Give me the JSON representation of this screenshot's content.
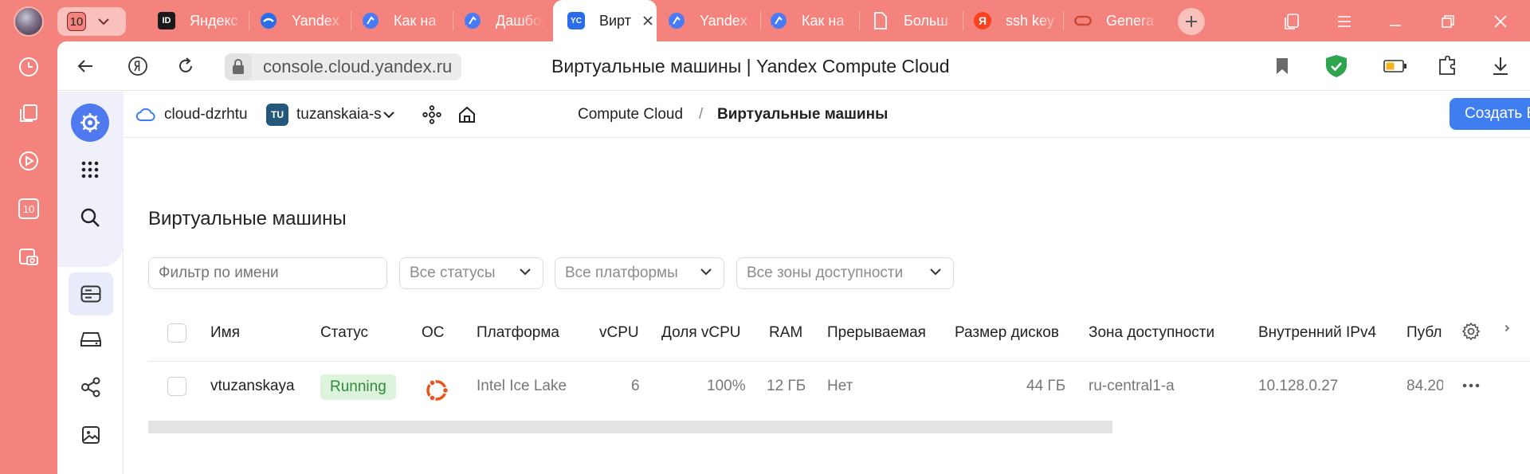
{
  "browser": {
    "counter": "10",
    "tabs": [
      {
        "label": "Яндекс",
        "icon": "id-icon",
        "color": "#1a1a1a"
      },
      {
        "label": "Yandex",
        "icon": "cloud-logo-icon",
        "color": "#2b6de8"
      },
      {
        "label": "Как на",
        "icon": "cloud-hand-icon",
        "color": "#4a7af5"
      },
      {
        "label": "Дашбор",
        "icon": "cloud-hand-icon",
        "color": "#4a7af5"
      },
      {
        "label": "Вирт",
        "icon": "yc-icon",
        "color": "#2b6de8",
        "active": true
      },
      {
        "label": "Yandex",
        "icon": "cloud-hand-icon",
        "color": "#4a7af5"
      },
      {
        "label": "Как на",
        "icon": "cloud-hand-icon",
        "color": "#4a7af5"
      },
      {
        "label": "Больш",
        "icon": "document-icon",
        "color": "#ffffff"
      },
      {
        "label": "ssh key",
        "icon": "yandex-y-icon",
        "color": "#fc3f1d"
      },
      {
        "label": "Genera",
        "icon": "oracle-icon",
        "color": "#c74634"
      }
    ],
    "active_tab_icon_text": "YC",
    "id_icon_text": "ID",
    "yandex_icon_text": "Я",
    "url": "console.cloud.yandex.ru",
    "page_title": "Виртуальные машины | Yandex Compute Cloud",
    "shield_color": "#2ea44f"
  },
  "console": {
    "breadcrumbs": {
      "cloud": "cloud-dzrhtu",
      "folder_badge": "TU",
      "folder": "tuzanskaia-s",
      "service": "Compute Cloud",
      "separator": "/",
      "current": "Виртуальные машины"
    },
    "create_button": "Создать ВМ",
    "accent": "#3e7ef1",
    "heading": "Виртуальные машины",
    "filters": {
      "name_placeholder": "Фильтр по имени",
      "status": "Все статусы",
      "platform": "Все платформы",
      "zone": "Все зоны доступности"
    },
    "columns": [
      "Имя",
      "Статус",
      "ОС",
      "Платформа",
      "vCPU",
      "Доля vCPU",
      "RAM",
      "Прерываемая",
      "Размер дисков",
      "Зона доступности",
      "Внутренний IPv4",
      "Публ"
    ],
    "rows": [
      {
        "name": "vtuzanskaya",
        "status": "Running",
        "os_icon": "ubuntu-icon",
        "platform": "Intel Ice Lake",
        "vcpu": "6",
        "vcpu_share": "100%",
        "ram": "12 ГБ",
        "preemptible": "Нет",
        "disk_size": "44 ГБ",
        "zone": "ru-central1-a",
        "internal_ipv4": "10.128.0.27",
        "public_ip": "84.20"
      }
    ]
  }
}
